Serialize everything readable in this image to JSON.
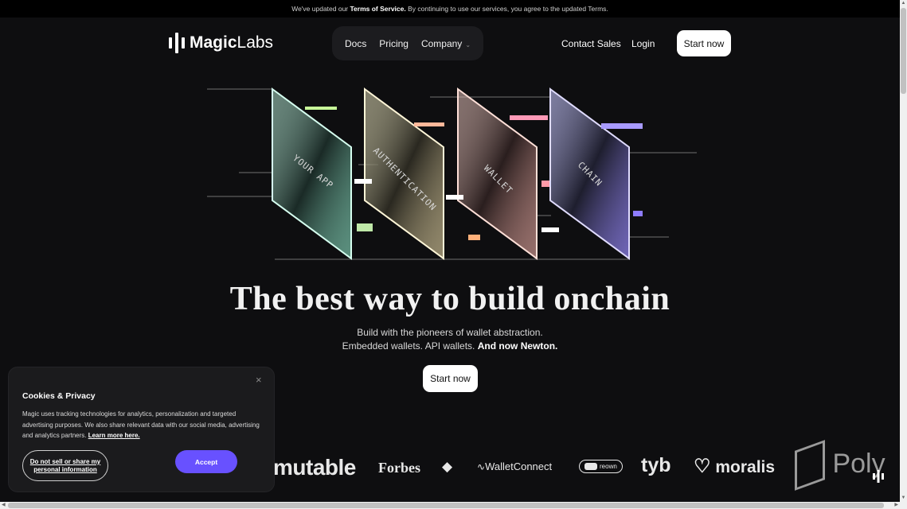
{
  "banner": {
    "pre": "We've updated our ",
    "tos": "Terms of Service.",
    "post": " By continuing to use our services, you agree to the updated Terms."
  },
  "brand": {
    "name_bold": "Magic",
    "name_light": "Labs"
  },
  "nav": {
    "docs": "Docs",
    "pricing": "Pricing",
    "company": "Company",
    "contact_sales": "Contact Sales",
    "login": "Login",
    "start_now": "Start now"
  },
  "hero": {
    "panels": [
      "YOUR APP",
      "AUTHENTICATION",
      "WALLET",
      "CHAIN"
    ],
    "headline": "The best way to build onchain",
    "sub_line1": "Build with the pioneers of wallet abstraction.",
    "sub_line2_plain": "Embedded wallets. API wallets. ",
    "sub_line2_bold": "And now Newton.",
    "cta": "Start now"
  },
  "partners": {
    "immutable": "mutable",
    "forbes": "Forbes",
    "walletconnect": "WalletConnect",
    "reown": "reown",
    "tyb": "tyb",
    "moralis": "moralis",
    "polygon": "Poly"
  },
  "cookie": {
    "title": "Cookies & Privacy",
    "body": "Magic uses tracking technologies for analytics, personalization and targeted advertising purposes. We also share relevant data with our social media, advertising and analytics partners. ",
    "learn_more": "Learn more here.",
    "dns_line1": "Do not sell or share my",
    "dns_line2": "personal information",
    "accept": "Accept",
    "close": "×"
  },
  "colors": {
    "accent": "#6851ff",
    "background": "#0e0e10",
    "banner": "#000000"
  }
}
